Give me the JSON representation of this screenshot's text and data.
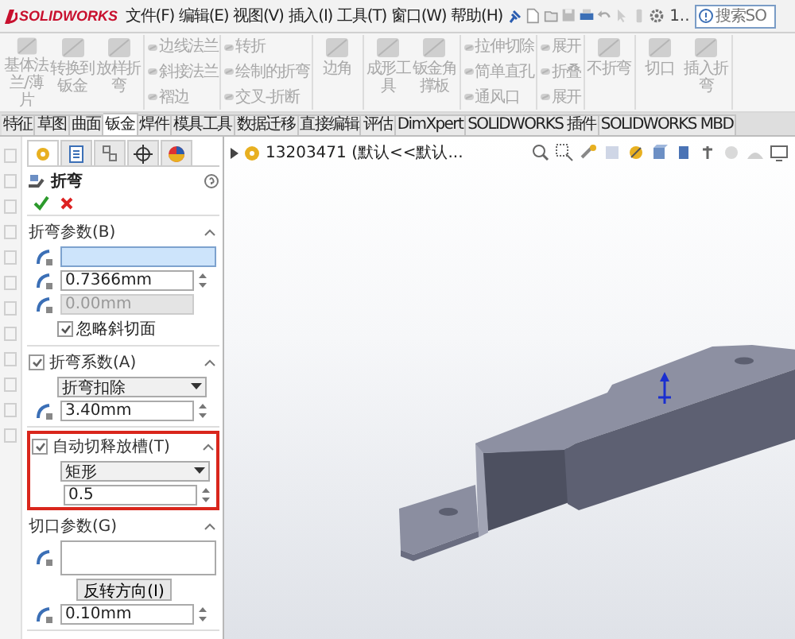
{
  "title_bar": {
    "logo": "SOLIDWORKS",
    "menus": [
      "文件(F)",
      "编辑(E)",
      "视图(V)",
      "插入(I)",
      "工具(T)",
      "窗口(W)",
      "帮助(H)"
    ],
    "recent_label": "1..",
    "search": {
      "placeholder": "搜索SO"
    }
  },
  "ribbon": {
    "groups": [
      {
        "kind": "large",
        "items": [
          {
            "label": "基体法兰/薄片",
            "disabled": true
          },
          {
            "label": "转换到钣金",
            "disabled": true
          },
          {
            "label": "放样折弯",
            "disabled": true
          }
        ]
      },
      {
        "kind": "small",
        "items": [
          {
            "label": "边线法兰",
            "disabled": true
          },
          {
            "label": "斜接法兰",
            "disabled": true
          },
          {
            "label": "褶边",
            "disabled": true
          }
        ]
      },
      {
        "kind": "small",
        "items": [
          {
            "label": "转折",
            "disabled": true
          },
          {
            "label": "绘制的折弯",
            "disabled": true
          },
          {
            "label": "交叉-折断",
            "disabled": true
          }
        ]
      },
      {
        "kind": "large",
        "items": [
          {
            "label": "边角",
            "disabled": true
          }
        ]
      },
      {
        "kind": "large",
        "items": [
          {
            "label": "成形工具",
            "disabled": true
          },
          {
            "label": "钣金角撑板",
            "disabled": true
          }
        ]
      },
      {
        "kind": "small",
        "items": [
          {
            "label": "拉伸切除",
            "disabled": true
          },
          {
            "label": "简单直孔",
            "disabled": true
          },
          {
            "label": "通风口",
            "disabled": true
          }
        ]
      },
      {
        "kind": "small",
        "items": [
          {
            "label": "展开",
            "disabled": true
          },
          {
            "label": "折叠",
            "disabled": true
          },
          {
            "label": "展开",
            "disabled": true
          }
        ]
      },
      {
        "kind": "large",
        "items": [
          {
            "label": "不折弯",
            "disabled": true
          }
        ]
      },
      {
        "kind": "large",
        "items": [
          {
            "label": "切口",
            "disabled": true
          },
          {
            "label": "插入折弯",
            "disabled": true
          }
        ]
      }
    ]
  },
  "command_tabs": [
    {
      "label": "特征",
      "selected": false
    },
    {
      "label": "草图",
      "selected": false
    },
    {
      "label": "曲面",
      "selected": false
    },
    {
      "label": "钣金",
      "selected": true
    },
    {
      "label": "焊件",
      "selected": false
    },
    {
      "label": "模具工具",
      "selected": false
    },
    {
      "label": "数据迁移",
      "selected": false
    },
    {
      "label": "直接编辑",
      "selected": false
    },
    {
      "label": "评估",
      "selected": false
    },
    {
      "label": "DimXpert",
      "selected": false
    },
    {
      "label": "SOLIDWORKS 插件",
      "selected": false
    },
    {
      "label": "SOLIDWORKS MBD",
      "selected": false
    }
  ],
  "property_manager": {
    "tabs": [
      {
        "selected": true
      },
      {
        "selected": false
      },
      {
        "selected": false
      },
      {
        "selected": false
      },
      {
        "selected": false
      }
    ],
    "title": "折弯",
    "sections": [
      {
        "title": "折弯参数(B)",
        "highlighted": false,
        "rows": [
          {
            "kind": "face_field",
            "active": true
          },
          {
            "kind": "spin",
            "with_icon": true,
            "value": "0.7366mm",
            "disabled": false
          },
          {
            "kind": "spin",
            "with_icon": true,
            "value": "0.00mm",
            "disabled": true
          },
          {
            "kind": "checkbox",
            "label": "忽略斜切面",
            "checked": true
          }
        ]
      },
      {
        "title": "折弯系数(A)",
        "checked": true,
        "highlighted": false,
        "rows": [
          {
            "kind": "dropdown",
            "value": "折弯扣除"
          },
          {
            "kind": "spin",
            "with_icon": true,
            "value": "3.40mm",
            "disabled": false
          }
        ]
      },
      {
        "title": "自动切释放槽(T)",
        "checked": true,
        "highlighted": true,
        "rows": [
          {
            "kind": "dropdown",
            "value": "矩形"
          },
          {
            "kind": "spin",
            "with_icon": false,
            "value": "0.5",
            "disabled": false
          }
        ]
      },
      {
        "title": "切口参数(G)",
        "highlighted": false,
        "rows": [
          {
            "kind": "list_field"
          },
          {
            "kind": "button",
            "label": "反转方向(I)"
          },
          {
            "kind": "spin",
            "with_icon": true,
            "value": "0.10mm",
            "disabled": false
          }
        ]
      }
    ]
  },
  "viewport": {
    "breadcrumb": "13203471  (默认<<默认..."
  }
}
